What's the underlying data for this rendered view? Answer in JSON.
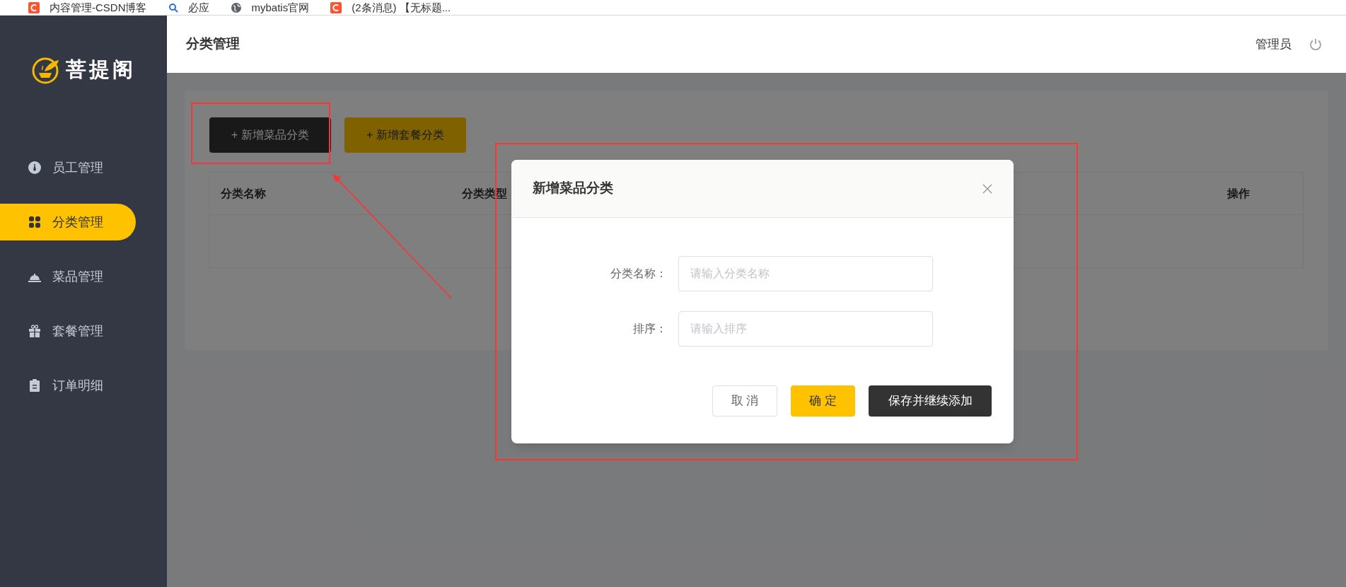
{
  "bookmarks": [
    {
      "label": "内容管理-CSDN博客",
      "kind": "csdn"
    },
    {
      "label": "必应",
      "kind": "search"
    },
    {
      "label": "mybatis官网",
      "kind": "globe"
    },
    {
      "label": "(2条消息) 【无标题...",
      "kind": "csdn"
    }
  ],
  "sidebar": {
    "logo_text": "菩提阁",
    "items": [
      {
        "label": "员工管理",
        "selected": false
      },
      {
        "label": "分类管理",
        "selected": true
      },
      {
        "label": "菜品管理",
        "selected": false
      },
      {
        "label": "套餐管理",
        "selected": false
      },
      {
        "label": "订单明细",
        "selected": false
      }
    ]
  },
  "header": {
    "title": "分类管理",
    "user": "管理员"
  },
  "toolbar": {
    "buttons": [
      {
        "label": "+ 新增菜品分类",
        "kind": "dark"
      },
      {
        "label": "+ 新增套餐分类",
        "kind": "yellow"
      }
    ]
  },
  "table": {
    "columns": [
      {
        "label": "分类名称",
        "kind": "left"
      },
      {
        "label": "分类类型",
        "kind": "left"
      },
      {
        "label": "操作",
        "kind": "right"
      }
    ]
  },
  "dialog": {
    "title": "新增菜品分类",
    "fields": [
      {
        "label": "分类名称：",
        "placeholder": "请输入分类名称"
      },
      {
        "label": "排序：",
        "placeholder": "请输入排序"
      }
    ],
    "buttons": [
      {
        "label": "取 消",
        "kind": "cancel"
      },
      {
        "label": "确 定",
        "kind": "confirm"
      },
      {
        "label": "保存并继续添加",
        "kind": "save"
      }
    ]
  }
}
